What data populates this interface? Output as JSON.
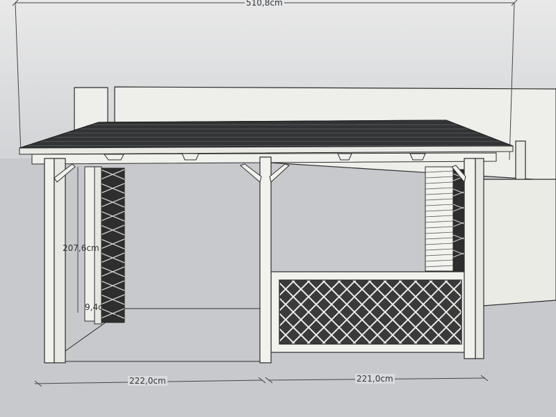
{
  "dimensions": {
    "total_width": "510,8cm",
    "height": "207,6cm",
    "left_bay": "222,0cm",
    "right_bay": "221,0cm",
    "partial_label": "9,4c"
  },
  "colors": {
    "sky_top": "#e8e8e8",
    "sky_bottom": "#d2d4d7",
    "ground": "#c6c8cc",
    "roof": "#2f3133",
    "timber": "#f1f1ed",
    "line": "#2b2b2b",
    "wall": "#eeeeea"
  }
}
